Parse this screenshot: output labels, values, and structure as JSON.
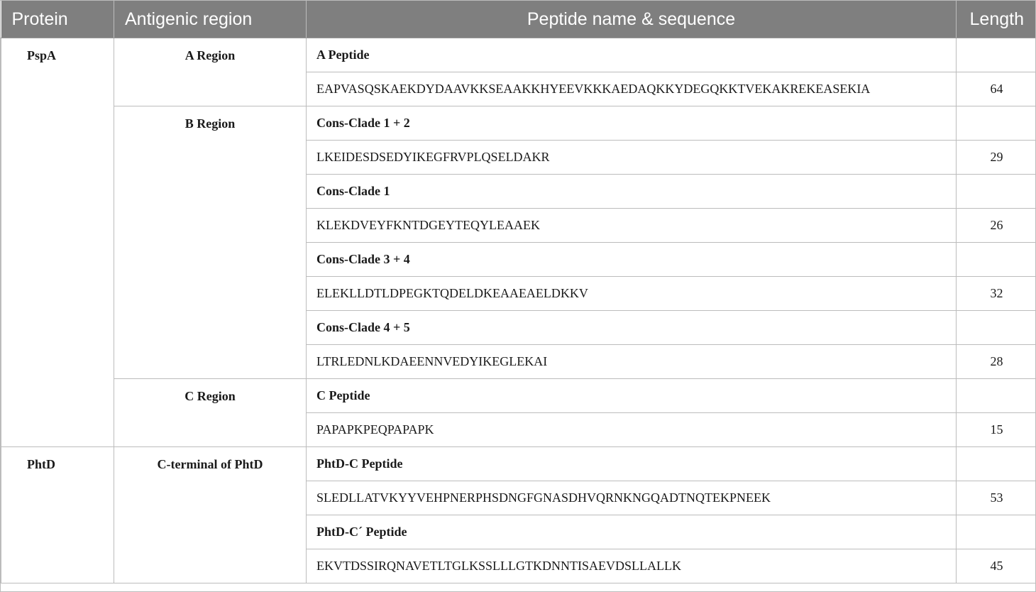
{
  "header": {
    "protein": "Protein",
    "antigenic_region": "Antigenic region",
    "peptide": "Peptide name & sequence",
    "length": "Length"
  },
  "groups": [
    {
      "protein": "PspA",
      "regions": [
        {
          "region": "A Region",
          "peptides": [
            {
              "name": "A Peptide",
              "sequence": "EAPVASQSKAEKDYDAAVKKSEAAKKHYEEVKKKAEDAQKKYDEGQKKTVEKAKREKEASEKIA",
              "length": "64"
            }
          ]
        },
        {
          "region": "B Region",
          "peptides": [
            {
              "name": "Cons-Clade 1 + 2",
              "sequence": "LKEIDESDSEDYIKEGFRVPLQSELDAKR",
              "length": "29"
            },
            {
              "name": "Cons-Clade 1",
              "sequence": "KLEKDVEYFKNTDGEYTEQYLEAAEK",
              "length": "26"
            },
            {
              "name": "Cons-Clade 3 + 4",
              "sequence": "ELEKLLDTLDPEGKTQDELDKEAAEAELDKKV",
              "length": "32"
            },
            {
              "name": "Cons-Clade 4 + 5",
              "sequence": "LTRLEDNLKDAEENNVEDYIKEGLEKAI",
              "length": "28"
            }
          ]
        },
        {
          "region": "C Region",
          "peptides": [
            {
              "name": "C Peptide",
              "sequence": "PAPAPKPEQPAPAPK",
              "length": "15"
            }
          ]
        }
      ]
    },
    {
      "protein": "PhtD",
      "regions": [
        {
          "region": "C-terminal of PhtD",
          "peptides": [
            {
              "name": "PhtD-C Peptide",
              "sequence": "SLEDLLATVKYYVEHPNERPHSDNGFGNASDHVQRNKNGQADTNQTEKPNEEK",
              "length": "53"
            },
            {
              "name": "PhtD-C´ Peptide",
              "sequence": "EKVTDSSIRQNAVETLTGLKSSLLLGTKDNNTISAEVDSLLALLK",
              "length": "45"
            }
          ]
        }
      ]
    }
  ]
}
